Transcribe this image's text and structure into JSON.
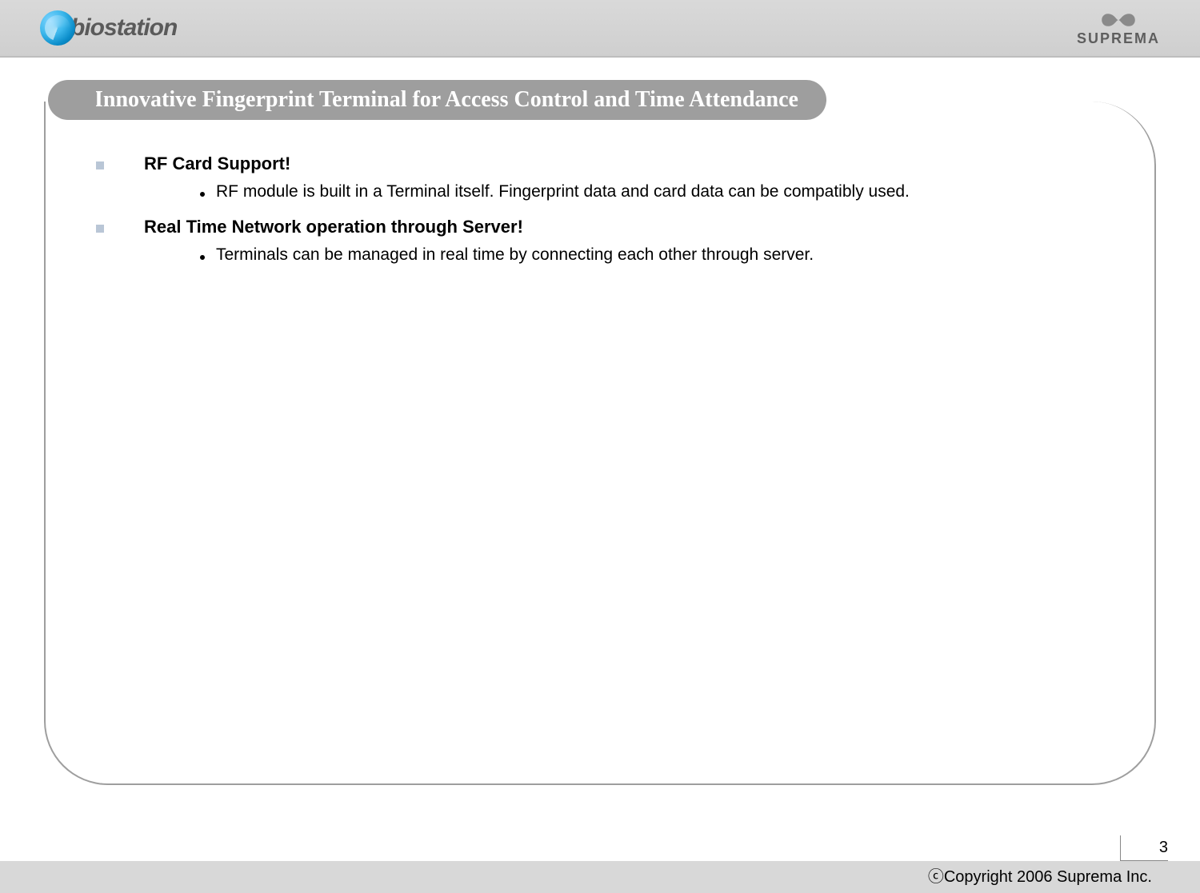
{
  "logos": {
    "left_text": "biostation",
    "right_text": "SUPREMA"
  },
  "slide": {
    "title": "Innovative Fingerprint Terminal for Access Control and Time Attendance"
  },
  "sections": [
    {
      "title": "RF Card Support!",
      "items": [
        "RF module is built in a Terminal itself. Fingerprint data and card data can be compatibly used."
      ]
    },
    {
      "title": "Real Time Network operation through Server!",
      "items": [
        "Terminals can be managed in real time by connecting each other through server."
      ]
    }
  ],
  "footer": {
    "page": "3",
    "copyright": "ⓒCopyright 2006 Suprema Inc."
  }
}
